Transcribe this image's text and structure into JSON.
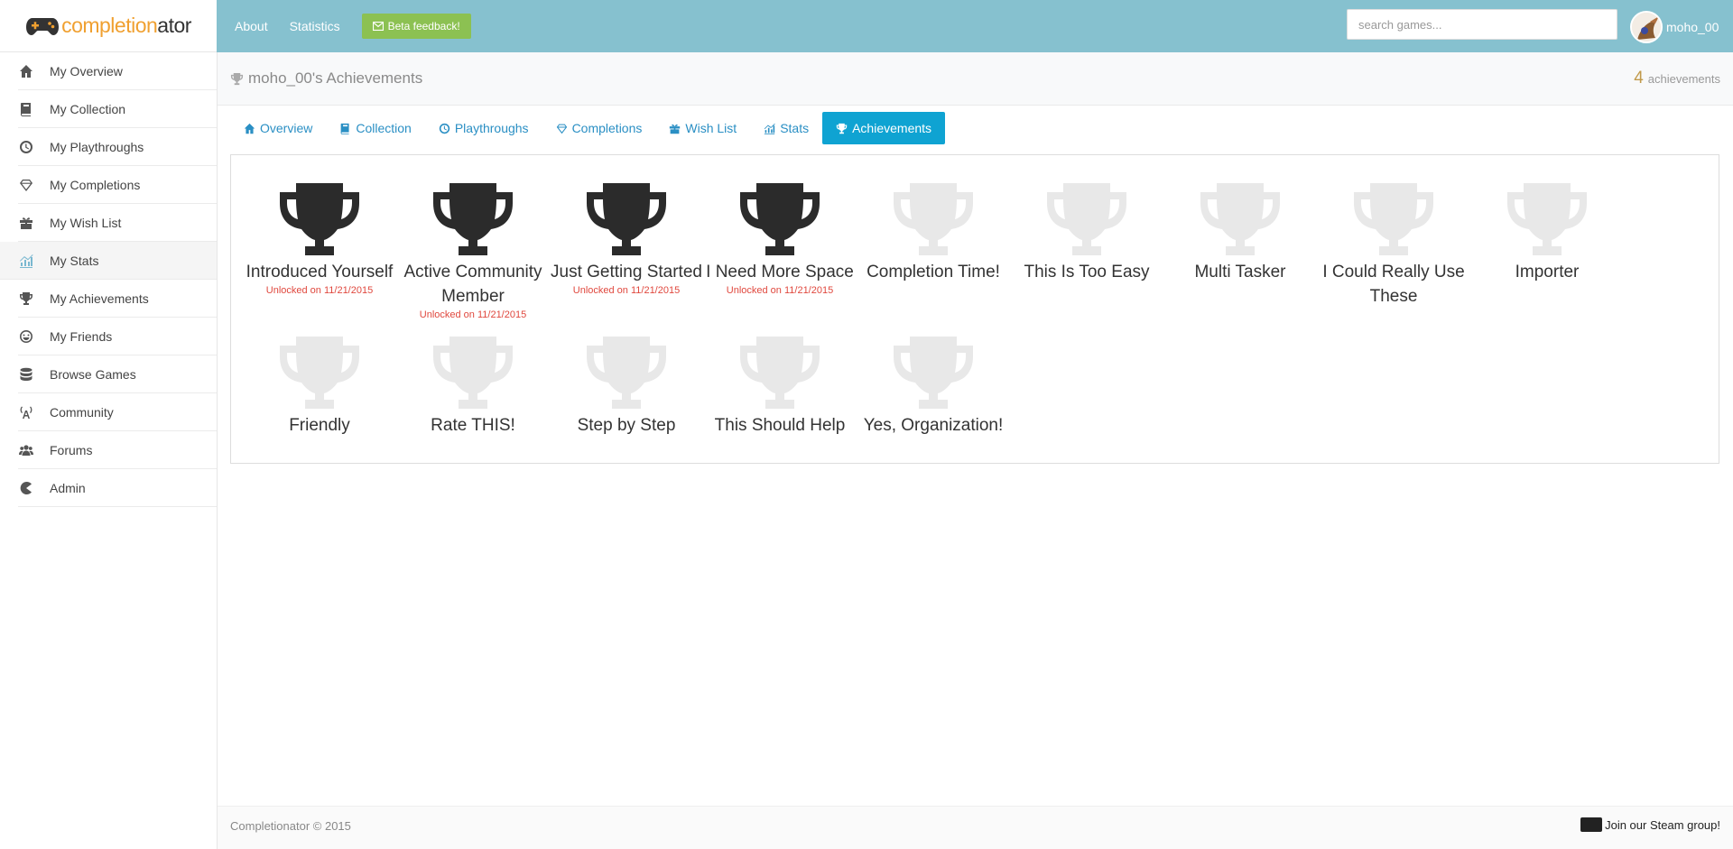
{
  "brand": {
    "name_part1": "completion",
    "name_part2": "ator"
  },
  "topnav": {
    "about": "About",
    "statistics": "Statistics",
    "beta": "Beta feedback!"
  },
  "search": {
    "placeholder": "search games..."
  },
  "user": {
    "name": "moho_00"
  },
  "sidebar": {
    "items": [
      {
        "label": "My Overview",
        "icon": "home-icon"
      },
      {
        "label": "My Collection",
        "icon": "book-icon"
      },
      {
        "label": "My Playthroughs",
        "icon": "clock-icon"
      },
      {
        "label": "My Completions",
        "icon": "diamond-icon"
      },
      {
        "label": "My Wish List",
        "icon": "gift-icon"
      },
      {
        "label": "My Stats",
        "icon": "chart-icon"
      },
      {
        "label": "My Achievements",
        "icon": "trophy-icon"
      },
      {
        "label": "My Friends",
        "icon": "smile-icon"
      },
      {
        "label": "Browse Games",
        "icon": "database-icon"
      },
      {
        "label": "Community",
        "icon": "broadcast-icon"
      },
      {
        "label": "Forums",
        "icon": "users-icon"
      },
      {
        "label": "Admin",
        "icon": "pacman-icon"
      }
    ],
    "active_index": 5
  },
  "header": {
    "title": "moho_00's Achievements",
    "count": "4",
    "count_label": "achievements"
  },
  "tabs": [
    {
      "label": "Overview",
      "icon": "home-icon"
    },
    {
      "label": "Collection",
      "icon": "book-icon"
    },
    {
      "label": "Playthroughs",
      "icon": "clock-icon"
    },
    {
      "label": "Completions",
      "icon": "diamond-icon"
    },
    {
      "label": "Wish List",
      "icon": "gift-icon"
    },
    {
      "label": "Stats",
      "icon": "chart-icon"
    },
    {
      "label": "Achievements",
      "icon": "trophy-icon"
    }
  ],
  "active_tab": 6,
  "achievements": [
    {
      "name": "Introduced Yourself",
      "unlocked": true,
      "unlock_text": "Unlocked on 11/21/2015"
    },
    {
      "name": "Active Community Member",
      "unlocked": true,
      "unlock_text": "Unlocked on 11/21/2015"
    },
    {
      "name": "Just Getting Started",
      "unlocked": true,
      "unlock_text": "Unlocked on 11/21/2015"
    },
    {
      "name": "I Need More Space",
      "unlocked": true,
      "unlock_text": "Unlocked on 11/21/2015"
    },
    {
      "name": "Completion Time!",
      "unlocked": false,
      "unlock_text": ""
    },
    {
      "name": "This Is Too Easy",
      "unlocked": false,
      "unlock_text": ""
    },
    {
      "name": "Multi Tasker",
      "unlocked": false,
      "unlock_text": ""
    },
    {
      "name": "I Could Really Use These",
      "unlocked": false,
      "unlock_text": ""
    },
    {
      "name": "Importer",
      "unlocked": false,
      "unlock_text": ""
    },
    {
      "name": "Friendly",
      "unlocked": false,
      "unlock_text": ""
    },
    {
      "name": "Rate THIS!",
      "unlocked": false,
      "unlock_text": ""
    },
    {
      "name": "Step by Step",
      "unlocked": false,
      "unlock_text": ""
    },
    {
      "name": "This Should Help",
      "unlocked": false,
      "unlock_text": ""
    },
    {
      "name": "Yes, Organization!",
      "unlocked": false,
      "unlock_text": ""
    }
  ],
  "colors": {
    "topbar": "#86c1cf",
    "accent": "#0fa3d2",
    "beta": "#8cc152",
    "unlock": "#e0483e",
    "count": "#c19a4b"
  },
  "footer": {
    "copyright": "Completionator © 2015",
    "steam": "Join our Steam group!"
  }
}
